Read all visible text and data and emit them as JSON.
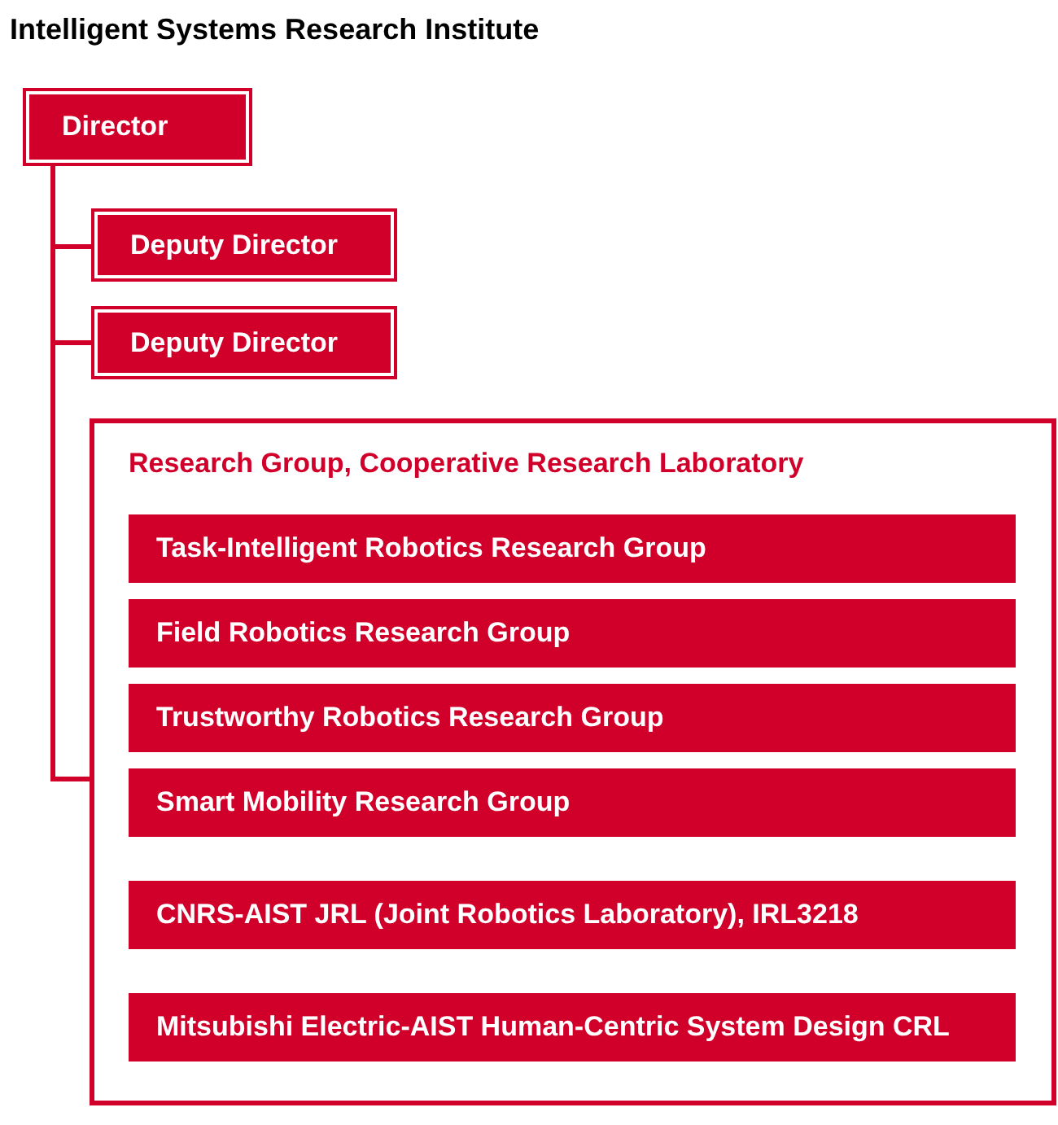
{
  "title": "Intelligent Systems Research Institute",
  "director": {
    "label": "Director"
  },
  "deputies": [
    {
      "label": "Deputy Director"
    },
    {
      "label": "Deputy Director"
    }
  ],
  "research_section": {
    "heading": "Research Group, Cooperative Research Laboratory",
    "units": [
      {
        "label": "Task-Intelligent Robotics Research Group",
        "kind": "group"
      },
      {
        "label": "Field Robotics Research Group",
        "kind": "group"
      },
      {
        "label": "Trustworthy Robotics Research Group",
        "kind": "group"
      },
      {
        "label": "Smart Mobility Research Group",
        "kind": "group"
      },
      {
        "label": "CNRS-AIST JRL (Joint Robotics Laboratory), IRL3218",
        "kind": "laboratory"
      },
      {
        "label": "Mitsubishi Electric-AIST Human-Centric System Design CRL",
        "kind": "laboratory"
      }
    ]
  }
}
